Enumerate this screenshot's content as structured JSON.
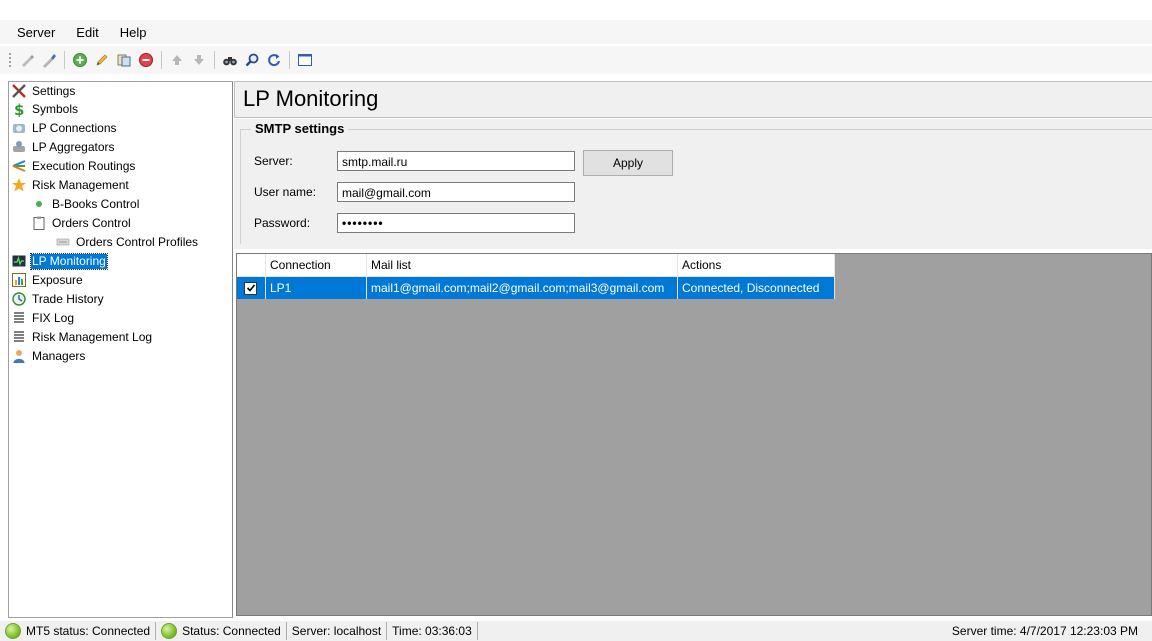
{
  "menu": {
    "items": [
      "Server",
      "Edit",
      "Help"
    ]
  },
  "toolbar": {
    "buttons": [
      "connect-icon",
      "disconnect-icon",
      "add-icon",
      "edit-icon",
      "copy-icon",
      "delete-icon",
      "move-up-icon",
      "move-down-icon",
      "find-icon",
      "search-icon",
      "refresh-icon",
      "window-icon"
    ]
  },
  "tree": {
    "items": [
      {
        "label": "Settings",
        "icon": "tools-icon",
        "level": 0
      },
      {
        "label": "Symbols",
        "icon": "dollar-icon",
        "level": 0
      },
      {
        "label": "LP Connections",
        "icon": "lp-connections-icon",
        "level": 0
      },
      {
        "label": "LP Aggregators",
        "icon": "lp-aggregators-icon",
        "level": 0
      },
      {
        "label": "Execution Routings",
        "icon": "routing-icon",
        "level": 0
      },
      {
        "label": "Risk Management",
        "icon": "risk-icon",
        "level": 0
      },
      {
        "label": "B-Books Control",
        "icon": "bbook-icon",
        "level": 1
      },
      {
        "label": "Orders Control",
        "icon": "clipboard-icon",
        "level": 1
      },
      {
        "label": "Orders Control Profiles",
        "icon": "profiles-icon",
        "level": 2
      },
      {
        "label": "LP Monitoring",
        "icon": "monitor-icon",
        "level": 0,
        "selected": true
      },
      {
        "label": "Exposure",
        "icon": "chart-icon",
        "level": 0
      },
      {
        "label": "Trade History",
        "icon": "history-icon",
        "level": 0
      },
      {
        "label": "FIX Log",
        "icon": "log-icon",
        "level": 0
      },
      {
        "label": "Risk Management Log",
        "icon": "log-icon",
        "level": 0
      },
      {
        "label": "Managers",
        "icon": "user-icon",
        "level": 0
      }
    ]
  },
  "main": {
    "title": "LP Monitoring",
    "smtp": {
      "legend": "SMTP settings",
      "server_label": "Server:",
      "server_value": "smtp.mail.ru",
      "user_label": "User name:",
      "user_value": "mail@gmail.com",
      "password_label": "Password:",
      "password_value": "••••••••",
      "apply_label": "Apply"
    },
    "grid": {
      "columns": [
        "Connection",
        "Mail list",
        "Actions"
      ],
      "rows": [
        {
          "checked": true,
          "connection": "LP1",
          "mail_list": "mail1@gmail.com;mail2@gmail.com;mail3@gmail.com",
          "actions": "Connected, Disconnected"
        }
      ]
    }
  },
  "status": {
    "mt5": "MT5 status: Connected",
    "status": "Status: Connected",
    "server": "Server: localhost",
    "time": "Time: 03:36:03",
    "server_time": "Server time: 4/7/2017 12:23:03 PM"
  },
  "colors": {
    "selection": "#0078d7",
    "panel": "#f0f0f0",
    "grid_bg": "#a0a0a0"
  }
}
